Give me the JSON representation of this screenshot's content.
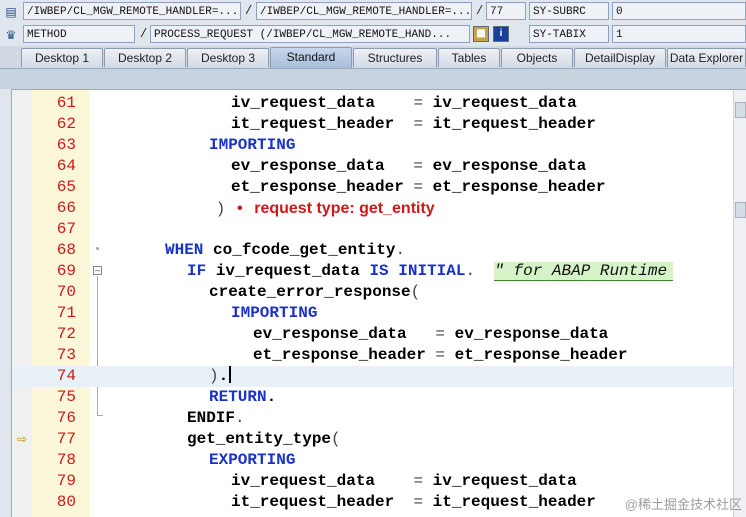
{
  "header": {
    "row1": {
      "field1": "/IWBEP/CL_MGW_REMOTE_HANDLER=...",
      "field2": "/IWBEP/CL_MGW_REMOTE_HANDLER=...",
      "field3": "77",
      "field4": "SY-SUBRC",
      "field5": "0"
    },
    "row2": {
      "field1": "METHOD",
      "field2": "PROCESS_REQUEST (/IWBEP/CL_MGW_REMOTE_HAND...",
      "field3": "SY-TABIX",
      "field4": "1",
      "info_label": "i"
    },
    "separator": "/"
  },
  "tabs": [
    {
      "label": "Desktop 1"
    },
    {
      "label": "Desktop 2"
    },
    {
      "label": "Desktop 3"
    },
    {
      "label": "Standard",
      "active": true
    },
    {
      "label": "Structures"
    },
    {
      "label": "Tables"
    },
    {
      "label": "Objects"
    },
    {
      "label": "DetailDisplay"
    },
    {
      "label": "Data Explorer"
    }
  ],
  "editor": {
    "hint_text": "request type: get_entity",
    "watermark": "@稀土掘金技术社区",
    "lines": [
      {
        "num": "61",
        "indent": 5,
        "tokens": [
          [
            "id",
            "iv_request_data"
          ],
          [
            "pn",
            "    = "
          ],
          [
            "id",
            "iv_request_data"
          ]
        ]
      },
      {
        "num": "62",
        "indent": 5,
        "tokens": [
          [
            "id",
            "it_request_header"
          ],
          [
            "pn",
            "  = "
          ],
          [
            "id",
            "it_request_header"
          ]
        ]
      },
      {
        "num": "63",
        "indent": 4,
        "tokens": [
          [
            "kw",
            "IMPORTING"
          ]
        ]
      },
      {
        "num": "64",
        "indent": 5,
        "tokens": [
          [
            "id",
            "ev_response_data"
          ],
          [
            "pn",
            "   = "
          ],
          [
            "id",
            "ev_response_data"
          ]
        ]
      },
      {
        "num": "65",
        "indent": 5,
        "tokens": [
          [
            "id",
            "et_response_header"
          ],
          [
            "pn",
            " = "
          ],
          [
            "id",
            "et_response_header"
          ]
        ]
      },
      {
        "num": "66",
        "indent": 3,
        "tokens": [
          [
            "pn",
            "   )"
          ],
          [
            "hint-dot",
            " • "
          ],
          [
            "hint",
            "request type: get_entity"
          ]
        ]
      },
      {
        "num": "67",
        "indent": 0,
        "tokens": []
      },
      {
        "num": "68",
        "indent": 2,
        "tokens": [
          [
            "kw",
            "WHEN"
          ],
          [
            "pn",
            " "
          ],
          [
            "id",
            "co_fcode_get_entity"
          ],
          [
            "pn",
            "."
          ]
        ]
      },
      {
        "num": "69",
        "indent": 3,
        "tokens": [
          [
            "kw",
            "IF"
          ],
          [
            "pn",
            " "
          ],
          [
            "id",
            "iv_request_data"
          ],
          [
            "pn",
            " "
          ],
          [
            "kw",
            "IS INITIAL"
          ],
          [
            "pn",
            ".  "
          ],
          [
            "cm",
            "\" for ABAP Runtime"
          ]
        ]
      },
      {
        "num": "70",
        "indent": 4,
        "tokens": [
          [
            "id",
            "create_error_response"
          ],
          [
            "pn",
            "("
          ]
        ]
      },
      {
        "num": "71",
        "indent": 5,
        "tokens": [
          [
            "kw",
            "IMPORTING"
          ]
        ]
      },
      {
        "num": "72",
        "indent": 6,
        "tokens": [
          [
            "id",
            "ev_response_data"
          ],
          [
            "pn",
            "   = "
          ],
          [
            "id",
            "ev_response_data"
          ]
        ]
      },
      {
        "num": "73",
        "indent": 6,
        "tokens": [
          [
            "id",
            "et_response_header"
          ],
          [
            "pn",
            " = "
          ],
          [
            "id",
            "et_response_header"
          ]
        ]
      },
      {
        "num": "74",
        "indent": 4,
        "tokens": [
          [
            "pn",
            ")"
          ],
          [
            "id",
            "."
          ]
        ],
        "cursor": true
      },
      {
        "num": "75",
        "indent": 4,
        "tokens": [
          [
            "kw",
            "RETURN"
          ],
          [
            "id",
            "."
          ]
        ]
      },
      {
        "num": "76",
        "indent": 3,
        "tokens": [
          [
            "id",
            "ENDIF"
          ],
          [
            "pn",
            "."
          ]
        ]
      },
      {
        "num": "77",
        "indent": 3,
        "tokens": [
          [
            "id",
            "get_entity_type"
          ],
          [
            "pn",
            "("
          ]
        ],
        "marker": true
      },
      {
        "num": "78",
        "indent": 4,
        "tokens": [
          [
            "kw",
            "EXPORTING"
          ]
        ]
      },
      {
        "num": "79",
        "indent": 5,
        "tokens": [
          [
            "id",
            "iv_request_data"
          ],
          [
            "pn",
            "    = "
          ],
          [
            "id",
            "iv_request_data"
          ]
        ]
      },
      {
        "num": "80",
        "indent": 5,
        "tokens": [
          [
            "id",
            "it_request_header"
          ],
          [
            "pn",
            "  = "
          ],
          [
            "id",
            "it_request_header"
          ]
        ]
      }
    ]
  }
}
